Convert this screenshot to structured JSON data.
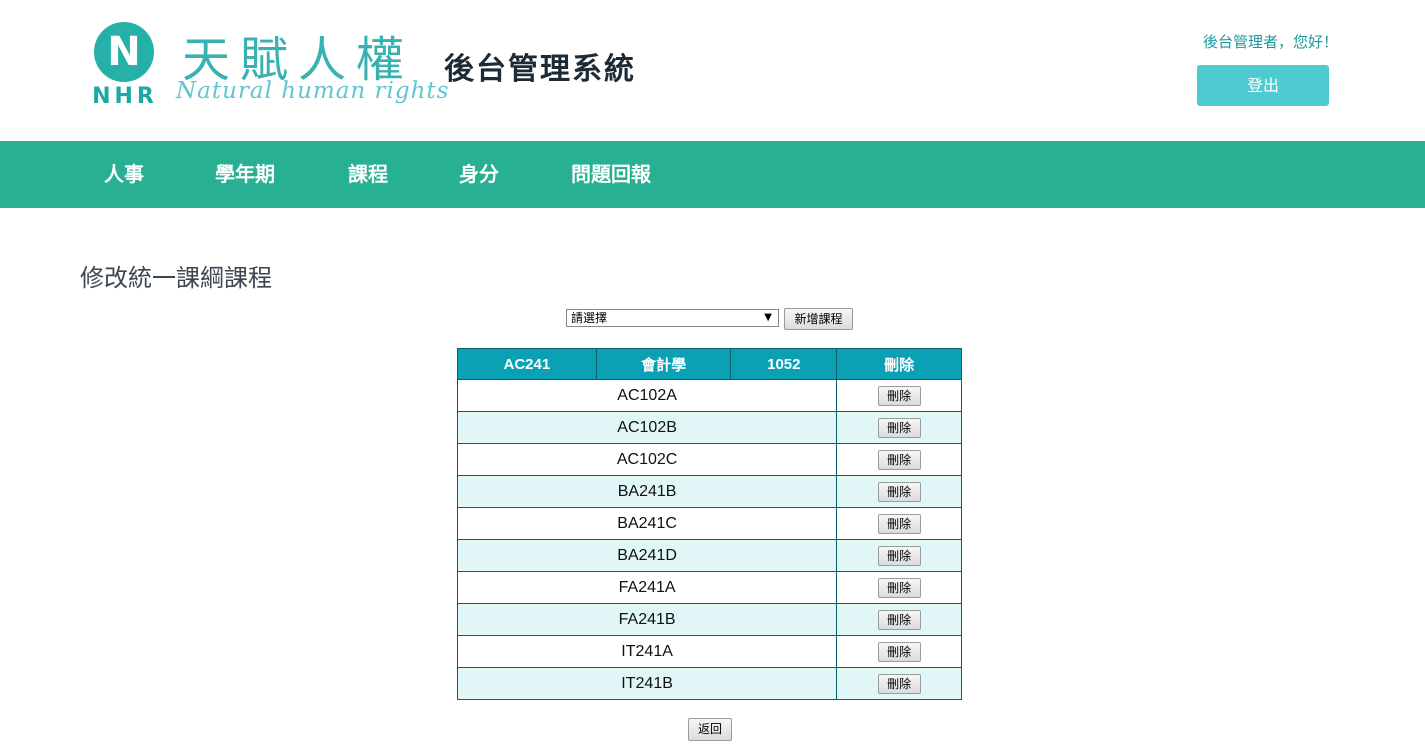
{
  "header": {
    "logo_letter": "N",
    "logo_abbr": "NHR",
    "logo_cn": "天賦人權",
    "logo_en": "Natural human rights",
    "system_title": "後台管理系統",
    "greeting": "後台管理者，您好！",
    "logout_label": "登出"
  },
  "nav": {
    "items": [
      {
        "label": "人事"
      },
      {
        "label": "學年期"
      },
      {
        "label": "課程"
      },
      {
        "label": "身分"
      },
      {
        "label": "問題回報"
      }
    ]
  },
  "main": {
    "title": "修改統一課綱課程",
    "select_value": "請選擇",
    "add_course_label": "新增課程",
    "back_label": "返回",
    "table": {
      "headers": [
        "AC241",
        "會計學",
        "1052",
        "刪除"
      ],
      "rows": [
        {
          "code": "AC102A",
          "action": "刪除"
        },
        {
          "code": "AC102B",
          "action": "刪除"
        },
        {
          "code": "AC102C",
          "action": "刪除"
        },
        {
          "code": "BA241B",
          "action": "刪除"
        },
        {
          "code": "BA241C",
          "action": "刪除"
        },
        {
          "code": "BA241D",
          "action": "刪除"
        },
        {
          "code": "FA241A",
          "action": "刪除"
        },
        {
          "code": "FA241B",
          "action": "刪除"
        },
        {
          "code": "IT241A",
          "action": "刪除"
        },
        {
          "code": "IT241B",
          "action": "刪除"
        }
      ]
    }
  },
  "colors": {
    "nav": "#27b091",
    "table_header": "#0aa1b5",
    "logout_button": "#4ecbd0",
    "alt_row": "#e0f6f7"
  }
}
